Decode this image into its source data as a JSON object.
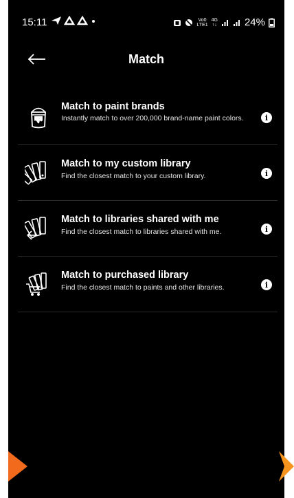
{
  "status_bar": {
    "time": "15:11",
    "battery": "24%",
    "network_top": "Vo0",
    "network_bottom": "LTE1",
    "signal_label_top": "4G",
    "signal_label_bottom": "↑↓"
  },
  "header": {
    "title": "Match"
  },
  "options": [
    {
      "title": "Match to paint brands",
      "description": "Instantly match to over 200,000 brand-name paint colors.",
      "icon": "paint-can-icon"
    },
    {
      "title": "Match to my custom library",
      "description": "Find the closest match to your custom library.",
      "icon": "color-fan-icon"
    },
    {
      "title": "Match to libraries shared with me",
      "description": "Find the closest match to libraries shared with me.",
      "icon": "shared-fan-icon"
    },
    {
      "title": "Match to purchased library",
      "description": "Find the closest match to paints and other libraries.",
      "icon": "cart-fan-icon"
    }
  ],
  "colors": {
    "background": "#000000",
    "text": "#ffffff",
    "nav_arrow": "#f26b1d"
  }
}
